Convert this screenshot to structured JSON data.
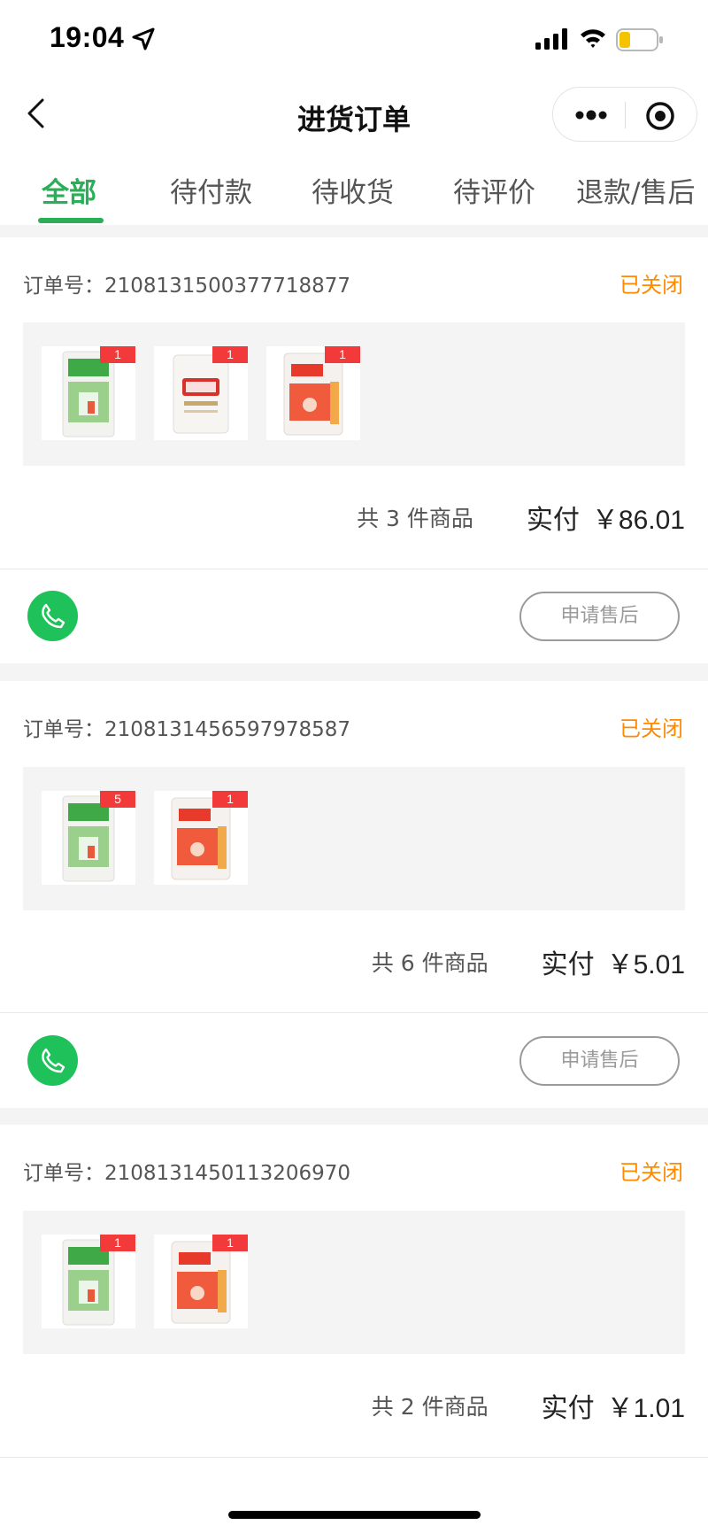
{
  "status_bar": {
    "time": "19:04"
  },
  "nav": {
    "title": "进货订单"
  },
  "tabs": [
    {
      "label": "全部",
      "active": true
    },
    {
      "label": "待付款",
      "active": false
    },
    {
      "label": "待收货",
      "active": false
    },
    {
      "label": "待评价",
      "active": false
    },
    {
      "label": "退款/售后",
      "active": false
    }
  ],
  "orders": [
    {
      "order_no": "订单号：2108131500377718877",
      "status": "已关闭",
      "items": [
        {
          "icon": "baiyijia-flour-bag",
          "qty": "1"
        },
        {
          "icon": "jinshahe-flour-bag",
          "qty": "1"
        },
        {
          "icon": "fada-flour-bag",
          "qty": "1"
        }
      ],
      "count_text": "共 3 件商品",
      "paid_label": "实付",
      "amount": "￥86.01",
      "after_sale_label": "申请售后"
    },
    {
      "order_no": "订单号：2108131456597978587",
      "status": "已关闭",
      "items": [
        {
          "icon": "baiyijia-flour-bag",
          "qty": "5"
        },
        {
          "icon": "fada-flour-bag",
          "qty": "1"
        }
      ],
      "count_text": "共 6 件商品",
      "paid_label": "实付",
      "amount": "￥5.01",
      "after_sale_label": "申请售后"
    },
    {
      "order_no": "订单号：2108131450113206970",
      "status": "已关闭",
      "items": [
        {
          "icon": "baiyijia-flour-bag",
          "qty": "1"
        },
        {
          "icon": "fada-flour-bag",
          "qty": "1"
        }
      ],
      "count_text": "共 2 件商品",
      "paid_label": "实付",
      "amount": "￥1.01"
    }
  ],
  "colors": {
    "accent_green": "#2bae57",
    "status_orange": "#ff8a00",
    "badge_red": "#f23a3a",
    "phone_green": "#1ec15a"
  }
}
